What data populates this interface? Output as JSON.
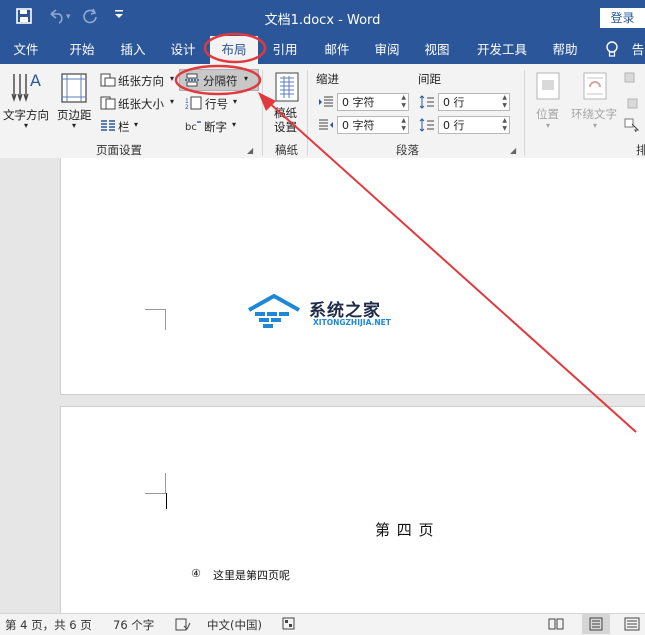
{
  "titlebar": {
    "title": "文档1.docx  -  Word",
    "login_label": "登录",
    "save_icon": "save-icon",
    "undo_icon": "undo-icon",
    "redo_icon": "redo-icon",
    "customize_icon": "customize-icon"
  },
  "tabs": [
    "文件",
    "开始",
    "插入",
    "设计",
    "布局",
    "引用",
    "邮件",
    "审阅",
    "视图",
    "开发工具",
    "帮助"
  ],
  "active_tab": "布局",
  "tellme": "告",
  "ribbon": {
    "text_direction": "文字方向",
    "margins": "页边距",
    "orientation": "纸张方向",
    "size": "纸张大小",
    "columns": "栏",
    "breaks": "分隔符",
    "line_numbers": "行号",
    "hyphenation": "断字",
    "group_page_setup": "页面设置",
    "draft_settings": "稿纸设置",
    "group_draft": "稿纸",
    "indent_label": "缩进",
    "spacing_label": "间距",
    "indent_left": "0 字符",
    "indent_right": "0 字符",
    "spacing_before": "0 行",
    "spacing_after": "0 行",
    "group_paragraph": "段落",
    "position": "位置",
    "wrap_text": "环绕文字",
    "group_arrange_partial": "排"
  },
  "document": {
    "watermark_name": "系统之家",
    "watermark_url": "XITONGZHIJIA.NET",
    "page4_heading": "第 四 页",
    "page4_list_marker": "④",
    "page4_text": "这里是第四页呢"
  },
  "status": {
    "page": "第 4 页，共 6 页",
    "words": "76 个字",
    "language": "中文(中国)"
  },
  "colors": {
    "accent": "#2b579a",
    "highlight": "#e0393e"
  }
}
